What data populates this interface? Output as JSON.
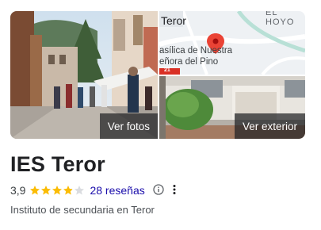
{
  "gallery": {
    "photos_button": "Ver fotos",
    "exterior_button": "Ver exterior",
    "map": {
      "label_town": "Teror",
      "label_area": "EL HOYO",
      "label_poi_line1": "asílica de Nuestra",
      "label_poi_line2": "eñora del Pino",
      "road_number": "21"
    }
  },
  "place": {
    "name": "IES Teror",
    "rating": "3,9",
    "rating_value": 3.9,
    "reviews": "28 reseñas",
    "category": "Instituto de secundaria en Teror"
  },
  "colors": {
    "star_filled": "#fbbc04",
    "star_empty": "#dadce0",
    "link": "#1a0dab",
    "map_pin": "#ea4335"
  }
}
